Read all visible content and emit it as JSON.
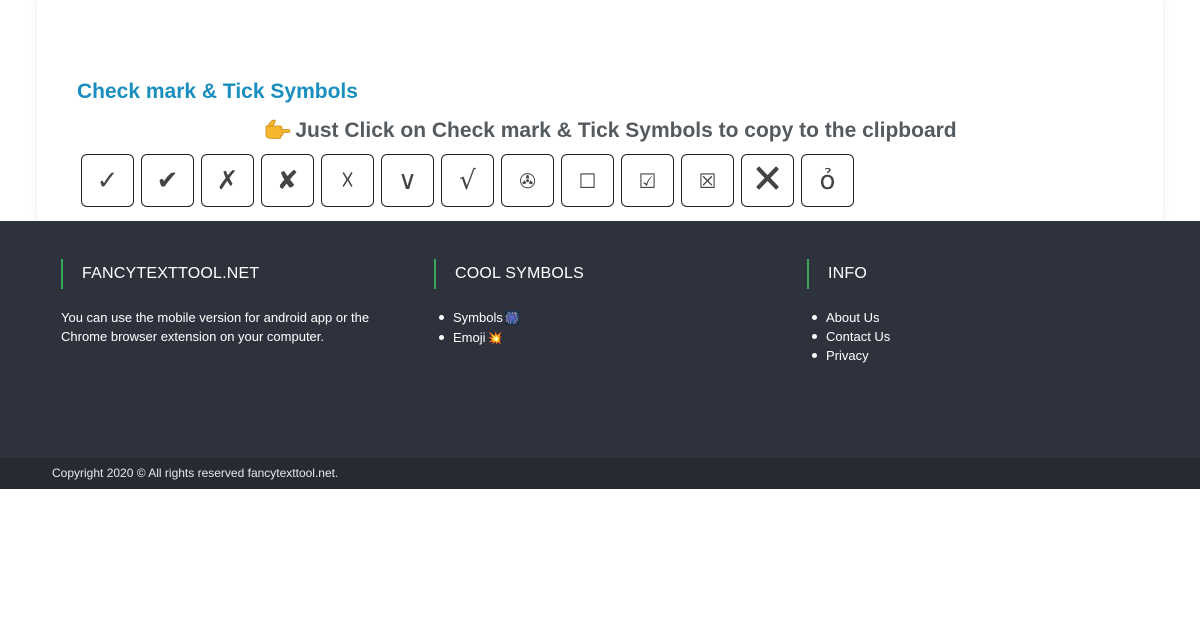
{
  "section": {
    "title": "Check mark & Tick Symbols",
    "instruction": "Just Click on Check mark & Tick Symbols to copy to the clipboard"
  },
  "symbols": [
    "✓",
    "✔",
    "✗",
    "✘",
    "☓",
    "∨",
    "√",
    "✇",
    "☐",
    "☑",
    "☒",
    "🗙",
    "ỏ"
  ],
  "footer": {
    "col1": {
      "title": "FANCYTEXTTOOL.NET",
      "text": "You can use the mobile version for android app or the Chrome browser extension on your computer."
    },
    "col2": {
      "title": "COOL SYMBOLS",
      "links": [
        {
          "label": "Symbols",
          "emoji": "🎆"
        },
        {
          "label": "Emoji",
          "emoji": "💥"
        }
      ]
    },
    "col3": {
      "title": "INFO",
      "links": [
        "About Us",
        "Contact Us",
        "Privacy"
      ]
    }
  },
  "copyright": "Copyright 2020 © All rights reserved fancytexttool.net.",
  "colors": {
    "accent": "#1a8fbf",
    "footer_bg": "#2d323d",
    "footer_bar": "#3aa65a",
    "copyright_bg": "#262a33"
  },
  "icons": {
    "instruction": "pointing-hand-icon"
  }
}
